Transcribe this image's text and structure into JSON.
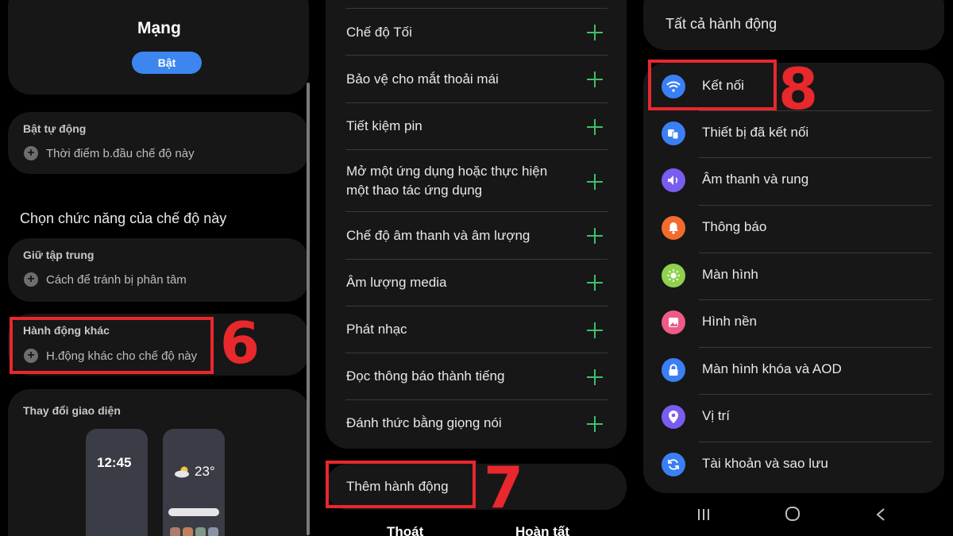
{
  "panel1": {
    "mode_title": "Mạng",
    "toggle_label": "Bật",
    "auto_on": {
      "title": "Bật tự động",
      "item": "Thời điểm b.đầu chế độ này"
    },
    "section_heading": "Chọn chức năng của chế độ này",
    "focus": {
      "title": "Giữ tập trung",
      "item": "Cách để tránh bị phân tâm"
    },
    "other_actions": {
      "title": "Hành động khác",
      "item": "H.động khác cho chế độ này"
    },
    "step_number": "6",
    "appearance": {
      "title": "Thay đổi giao diện",
      "lock_time": "12:45",
      "temperature": "23°"
    }
  },
  "panel2": {
    "actions": [
      "Chế độ Tối",
      "Bảo vệ cho mắt thoải mái",
      "Tiết kiệm pin",
      "Mở một ứng dụng hoặc thực hiện một thao tác ứng dụng",
      "Chế độ âm thanh và âm lượng",
      "Âm lượng media",
      "Phát nhạc",
      "Đọc thông báo thành tiếng",
      "Đánh thức bằng giọng nói"
    ],
    "add_action": "Thêm hành động",
    "step_number": "7",
    "exit_label": "Thoát",
    "done_label": "Hoàn tất"
  },
  "panel3": {
    "header": "Tất cả hành động",
    "step_number": "8",
    "items": [
      {
        "label": "Kết nối",
        "icon": "wifi-icon",
        "color": "#3b7ff5"
      },
      {
        "label": "Thiết bị đã kết nối",
        "icon": "devices-icon",
        "color": "#3b7ff5"
      },
      {
        "label": "Âm thanh và rung",
        "icon": "volume-icon",
        "color": "#7a5cf0"
      },
      {
        "label": "Thông báo",
        "icon": "bell-icon",
        "color": "#f26a2e"
      },
      {
        "label": "Màn hình",
        "icon": "sun-icon",
        "color": "#8fd14f"
      },
      {
        "label": "Hình nền",
        "icon": "image-icon",
        "color": "#ef5a86"
      },
      {
        "label": "Màn hình khóa và AOD",
        "icon": "lock-icon",
        "color": "#3b7ff5"
      },
      {
        "label": "Vị trí",
        "icon": "location-icon",
        "color": "#7a5cf0"
      },
      {
        "label": "Tài khoản và sao lưu",
        "icon": "sync-icon",
        "color": "#3b7ff5"
      }
    ]
  }
}
